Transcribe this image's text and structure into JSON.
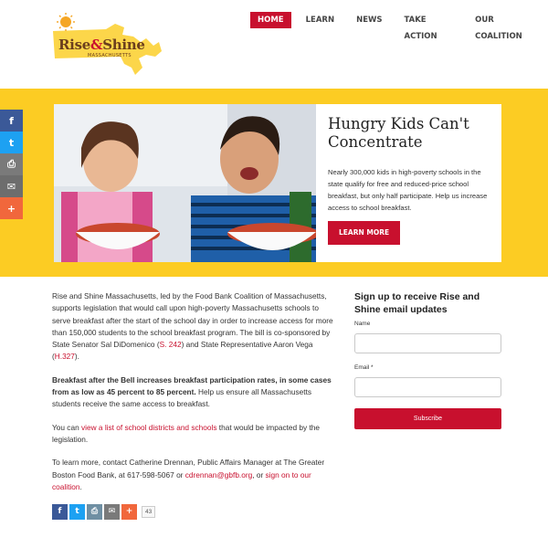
{
  "header": {
    "logo_text_1": "Rise",
    "logo_amp": "&",
    "logo_text_2": "Shine",
    "logo_sub": "MASSACHUSETTS",
    "nav": [
      "HOME",
      "LEARN",
      "NEWS",
      "TAKE ACTION",
      "OUR COALITION"
    ]
  },
  "social_sidebar": [
    {
      "icon": "facebook-icon",
      "glyph": "f",
      "color": "#3b5998"
    },
    {
      "icon": "twitter-icon",
      "glyph": "t",
      "color": "#1da1f2"
    },
    {
      "icon": "print-icon",
      "glyph": "⎙",
      "color": "#7a7a7a"
    },
    {
      "icon": "email-icon",
      "glyph": "✉",
      "color": "#6d6d6d"
    },
    {
      "icon": "share-more-icon",
      "glyph": "+",
      "color": "#f1673c"
    }
  ],
  "hero": {
    "title": "Hungry Kids Can't Concentrate",
    "text": "Nearly 300,000 kids in high-poverty schools in the state qualify for free and reduced-price school breakfast, but only half participate. Help us increase access to school breakfast.",
    "button": "LEARN MORE"
  },
  "main": {
    "p1_a": "Rise and Shine Massachusetts, led by the Food Bank Coalition of Massachusetts, supports legislation that would call upon high-poverty Massachusetts schools to serve breakfast after the start of the school day in order to increase access for more than 150,000 students to the school breakfast program. The bill is co-sponsored by State Senator Sal DiDomenico (",
    "p1_link1": "S. 242",
    "p1_b": ") and State Representative Aaron Vega (",
    "p1_link2": "H.327",
    "p1_c": ").",
    "p2_bold": "Breakfast after the Bell increases breakfast participation rates, in some cases from as low as 45 percent to 85 percent.",
    "p2_rest": " Help us ensure all Massachusetts students receive the same access to breakfast.",
    "p3_a": "You can ",
    "p3_link": "view a list of school districts and schools",
    "p3_b": " that would be impacted by the legislation.",
    "p4_a": "To learn more, contact Catherine Drennan, Public Affairs Manager at The Greater Boston Food Bank, at 617-598-5067 or ",
    "p4_link1": "cdrennan@gbfb.org",
    "p4_b": ", or ",
    "p4_link2": "sign on to our coalition",
    "p4_c": ".",
    "share_count": "43"
  },
  "share_row": [
    {
      "icon": "facebook-icon",
      "glyph": "f",
      "color": "#3b5998"
    },
    {
      "icon": "twitter-icon",
      "glyph": "t",
      "color": "#1da1f2"
    },
    {
      "icon": "print-icon",
      "glyph": "⎙",
      "color": "#6f8fa3"
    },
    {
      "icon": "email-icon",
      "glyph": "✉",
      "color": "#7a7a7a"
    },
    {
      "icon": "share-more-icon",
      "glyph": "+",
      "color": "#f1673c"
    }
  ],
  "signup": {
    "title": "Sign up to receive Rise and Shine email updates",
    "name_label": "Name",
    "email_label": "Email *",
    "button": "Subscribe"
  }
}
